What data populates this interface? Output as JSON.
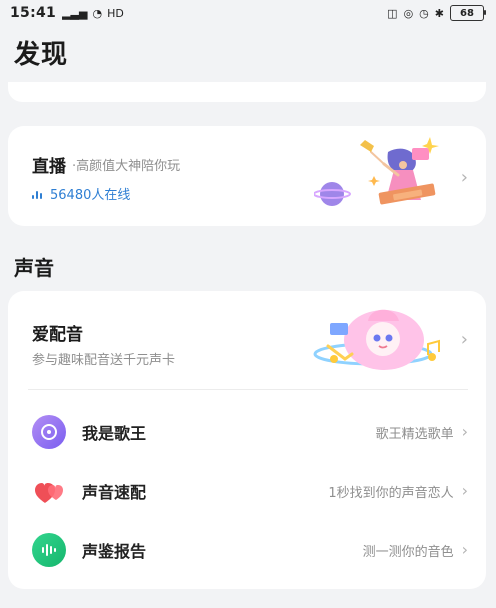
{
  "status_bar": {
    "time": "15:41",
    "left_icons": [
      "signal-icon",
      "wifi-icon",
      "hd-icon"
    ],
    "right_icons": [
      "mute-icon",
      "record-icon",
      "alarm-icon",
      "bluetooth-icon"
    ],
    "battery": "68"
  },
  "page": {
    "title": "发现"
  },
  "live": {
    "title": "直播",
    "subtitle": "·高颜值大神陪你玩",
    "online": "56480人在线"
  },
  "voice_section": {
    "title": "声音",
    "dubbing": {
      "title": "爱配音",
      "subtitle": "参与趣味配音送千元声卡"
    },
    "items": [
      {
        "label": "我是歌王",
        "desc": "歌王精选歌单"
      },
      {
        "label": "声音速配",
        "desc": "1秒找到你的声音恋人"
      },
      {
        "label": "声鉴报告",
        "desc": "测一测你的音色"
      }
    ]
  },
  "colors": {
    "link_blue": "#2f7fd3",
    "purple": "#8e6ee8",
    "coral": "#ef4f57",
    "mint": "#21c87a"
  }
}
